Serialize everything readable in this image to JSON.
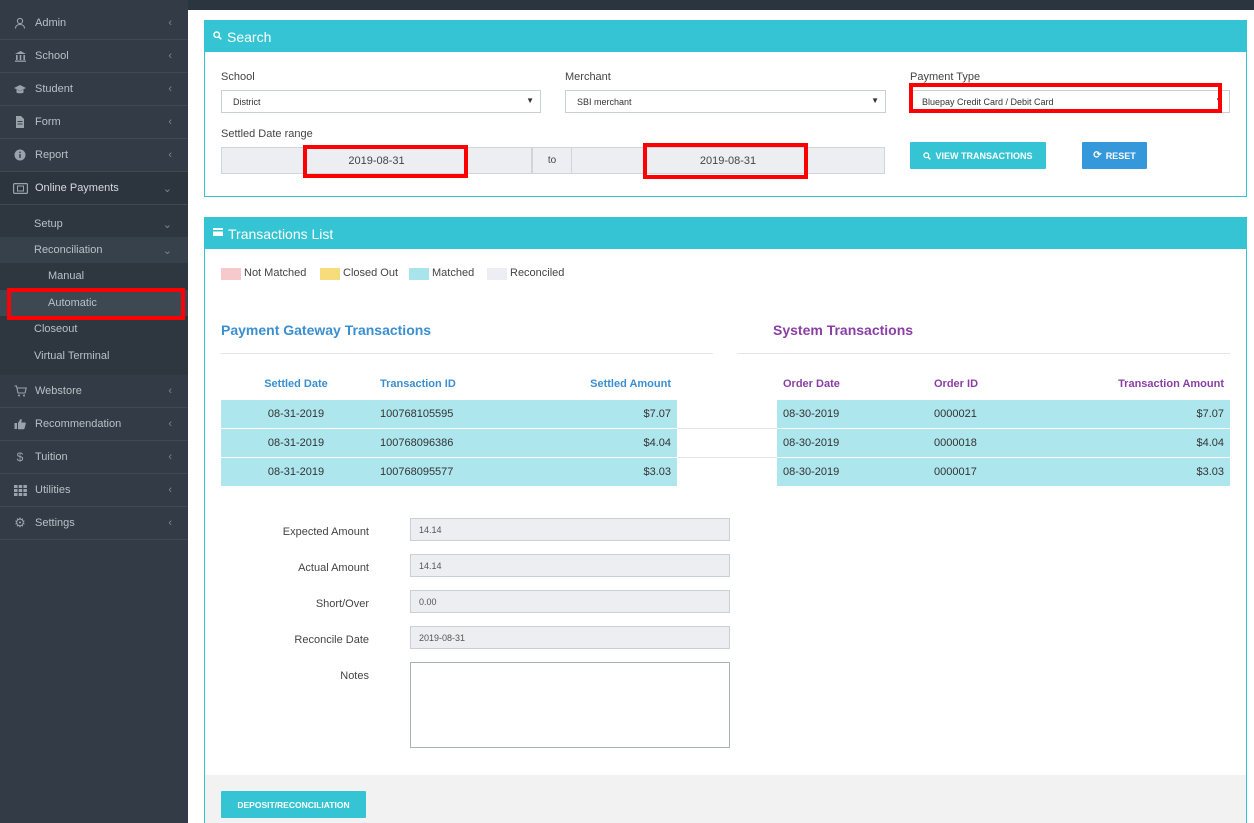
{
  "sidebar": {
    "items": [
      {
        "label": "Admin",
        "icon": "user-icon"
      },
      {
        "label": "School",
        "icon": "bank-icon"
      },
      {
        "label": "Student",
        "icon": "graduation-cap-icon"
      },
      {
        "label": "Form",
        "icon": "document-icon"
      },
      {
        "label": "Report",
        "icon": "info-icon"
      },
      {
        "label": "Online Payments",
        "icon": "credit-card-icon"
      }
    ],
    "subitems": {
      "setup": "Setup",
      "reconciliation": "Reconciliation",
      "manual": "Manual",
      "automatic": "Automatic",
      "closeout": "Closeout",
      "virtual_terminal": "Virtual Terminal"
    },
    "bottom_items": [
      {
        "label": "Webstore",
        "icon": "cart-icon"
      },
      {
        "label": "Recommendation",
        "icon": "thumbs-up-icon"
      },
      {
        "label": "Tuition",
        "icon": "dollar-icon"
      },
      {
        "label": "Utilities",
        "icon": "grid-icon"
      },
      {
        "label": "Settings",
        "icon": "gear-icon"
      }
    ]
  },
  "search": {
    "title": "Search",
    "school_label": "School",
    "school_value": "District",
    "merchant_label": "Merchant",
    "merchant_value": "SBI merchant",
    "payment_type_label": "Payment Type",
    "payment_type_value": "Bluepay Credit Card / Debit Card",
    "date_range_label": "Settled Date range",
    "date_from": "2019-08-31",
    "date_to_sep": "to",
    "date_to": "2019-08-31",
    "view_button": "VIEW TRANSACTIONS",
    "reset_button": "RESET"
  },
  "transactions": {
    "title": "Transactions List",
    "legend": [
      {
        "label": "Not Matched",
        "color": "#f6c9cc"
      },
      {
        "label": "Closed Out",
        "color": "#f7dc7b"
      },
      {
        "label": "Matched",
        "color": "#a9e4ec"
      },
      {
        "label": "Reconciled",
        "color": "#eceef3"
      }
    ],
    "gateway_title": "Payment Gateway Transactions",
    "system_title": "System Transactions",
    "gateway_headers": [
      "Settled Date",
      "Transaction ID",
      "Settled Amount"
    ],
    "system_headers": [
      "Order Date",
      "Order ID",
      "Transaction Amount"
    ],
    "gateway_rows": [
      [
        "08-31-2019",
        "100768105595",
        "$7.07"
      ],
      [
        "08-31-2019",
        "100768096386",
        "$4.04"
      ],
      [
        "08-31-2019",
        "100768095577",
        "$3.03"
      ]
    ],
    "system_rows": [
      [
        "08-30-2019",
        "0000021",
        "$7.07"
      ],
      [
        "08-30-2019",
        "0000018",
        "$4.04"
      ],
      [
        "08-30-2019",
        "0000017",
        "$3.03"
      ]
    ],
    "colors": {
      "gateway_accent": "#3a8fd0",
      "system_accent": "#8a3fa6",
      "matched_row": "#aee6ed"
    }
  },
  "form": {
    "expected_label": "Expected Amount",
    "expected_value": "14.14",
    "actual_label": "Actual Amount",
    "actual_value": "14.14",
    "short_label": "Short/Over",
    "short_value": "0.00",
    "date_label": "Reconcile Date",
    "date_value": "2019-08-31",
    "notes_label": "Notes",
    "submit_button": "DEPOSIT/RECONCILIATION"
  }
}
